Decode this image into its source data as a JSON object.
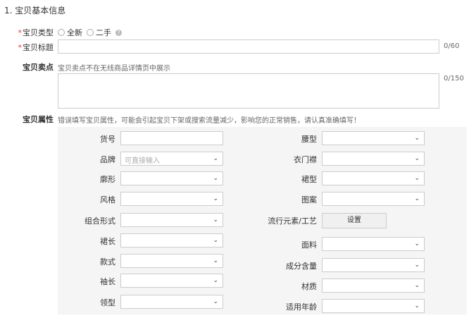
{
  "section": {
    "title": "1. 宝贝基本信息"
  },
  "required_mark": "*",
  "type_row": {
    "label": "宝贝类型",
    "options": [
      "全新",
      "二手"
    ],
    "help": "?"
  },
  "title_row": {
    "label": "宝贝标题",
    "counter": "0/60",
    "value": ""
  },
  "selling_row": {
    "label": "宝贝卖点",
    "hint": "宝贝卖点不在无线商品详情页中展示",
    "counter": "0/150",
    "value": ""
  },
  "attr_row": {
    "label": "宝贝属性",
    "hint": "错误填写宝贝属性，可能会引起宝贝下架或搜索流量减少，影响您的正常销售，请认真准确填写！"
  },
  "attributes": {
    "left": [
      {
        "label": "货号",
        "kind": "text",
        "value": ""
      },
      {
        "label": "品牌",
        "kind": "select",
        "placeholder": "可直接输入"
      },
      {
        "label": "廓形",
        "kind": "select",
        "value": ""
      },
      {
        "label": "风格",
        "kind": "select",
        "value": ""
      },
      {
        "label": "组合形式",
        "kind": "select",
        "value": ""
      },
      {
        "label": "裙长",
        "kind": "select",
        "value": ""
      },
      {
        "label": "款式",
        "kind": "select",
        "value": ""
      },
      {
        "label": "袖长",
        "kind": "select",
        "value": ""
      },
      {
        "label": "领型",
        "kind": "select",
        "value": ""
      }
    ],
    "right": [
      {
        "label": "腰型",
        "kind": "select",
        "value": ""
      },
      {
        "label": "衣门襟",
        "kind": "select",
        "value": ""
      },
      {
        "label": "裙型",
        "kind": "select",
        "value": ""
      },
      {
        "label": "图案",
        "kind": "select",
        "value": ""
      },
      {
        "label": "流行元素/工艺",
        "kind": "button",
        "button_label": "设置"
      },
      {
        "label": "面料",
        "kind": "select",
        "value": ""
      },
      {
        "label": "成分含量",
        "kind": "select",
        "value": ""
      },
      {
        "label": "材质",
        "kind": "select",
        "value": ""
      },
      {
        "label": "适用年龄",
        "kind": "select",
        "value": ""
      }
    ]
  },
  "icons": {
    "chevron": "chevron-down-icon",
    "help": "help-icon"
  }
}
